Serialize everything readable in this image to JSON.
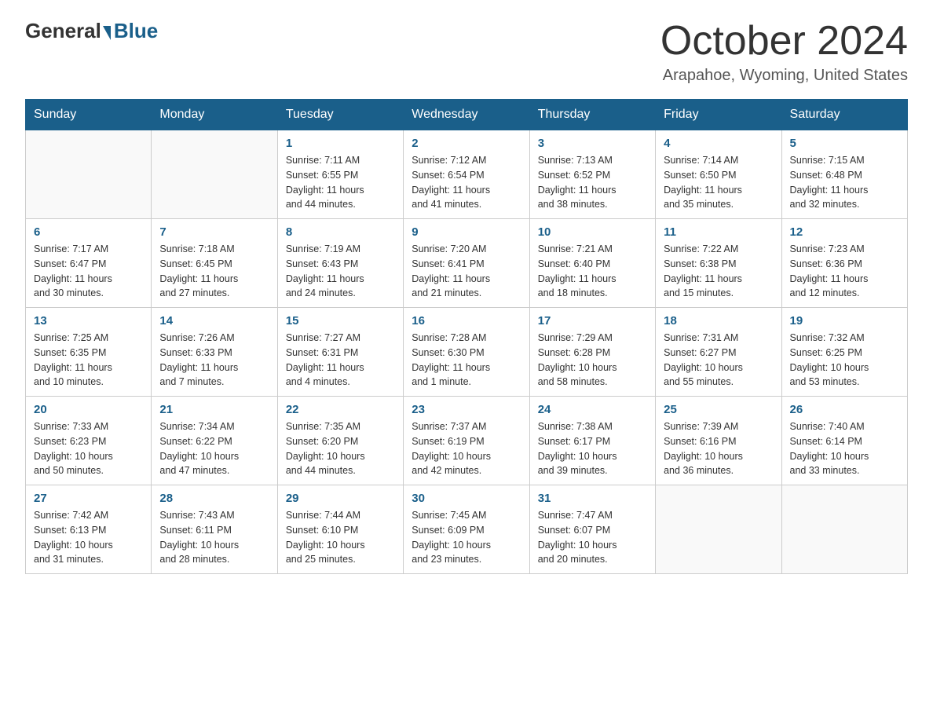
{
  "header": {
    "logo_general": "General",
    "logo_blue": "Blue",
    "month": "October 2024",
    "location": "Arapahoe, Wyoming, United States"
  },
  "days_of_week": [
    "Sunday",
    "Monday",
    "Tuesday",
    "Wednesday",
    "Thursday",
    "Friday",
    "Saturday"
  ],
  "weeks": [
    [
      {
        "day": "",
        "info": ""
      },
      {
        "day": "",
        "info": ""
      },
      {
        "day": "1",
        "info": "Sunrise: 7:11 AM\nSunset: 6:55 PM\nDaylight: 11 hours\nand 44 minutes."
      },
      {
        "day": "2",
        "info": "Sunrise: 7:12 AM\nSunset: 6:54 PM\nDaylight: 11 hours\nand 41 minutes."
      },
      {
        "day": "3",
        "info": "Sunrise: 7:13 AM\nSunset: 6:52 PM\nDaylight: 11 hours\nand 38 minutes."
      },
      {
        "day": "4",
        "info": "Sunrise: 7:14 AM\nSunset: 6:50 PM\nDaylight: 11 hours\nand 35 minutes."
      },
      {
        "day": "5",
        "info": "Sunrise: 7:15 AM\nSunset: 6:48 PM\nDaylight: 11 hours\nand 32 minutes."
      }
    ],
    [
      {
        "day": "6",
        "info": "Sunrise: 7:17 AM\nSunset: 6:47 PM\nDaylight: 11 hours\nand 30 minutes."
      },
      {
        "day": "7",
        "info": "Sunrise: 7:18 AM\nSunset: 6:45 PM\nDaylight: 11 hours\nand 27 minutes."
      },
      {
        "day": "8",
        "info": "Sunrise: 7:19 AM\nSunset: 6:43 PM\nDaylight: 11 hours\nand 24 minutes."
      },
      {
        "day": "9",
        "info": "Sunrise: 7:20 AM\nSunset: 6:41 PM\nDaylight: 11 hours\nand 21 minutes."
      },
      {
        "day": "10",
        "info": "Sunrise: 7:21 AM\nSunset: 6:40 PM\nDaylight: 11 hours\nand 18 minutes."
      },
      {
        "day": "11",
        "info": "Sunrise: 7:22 AM\nSunset: 6:38 PM\nDaylight: 11 hours\nand 15 minutes."
      },
      {
        "day": "12",
        "info": "Sunrise: 7:23 AM\nSunset: 6:36 PM\nDaylight: 11 hours\nand 12 minutes."
      }
    ],
    [
      {
        "day": "13",
        "info": "Sunrise: 7:25 AM\nSunset: 6:35 PM\nDaylight: 11 hours\nand 10 minutes."
      },
      {
        "day": "14",
        "info": "Sunrise: 7:26 AM\nSunset: 6:33 PM\nDaylight: 11 hours\nand 7 minutes."
      },
      {
        "day": "15",
        "info": "Sunrise: 7:27 AM\nSunset: 6:31 PM\nDaylight: 11 hours\nand 4 minutes."
      },
      {
        "day": "16",
        "info": "Sunrise: 7:28 AM\nSunset: 6:30 PM\nDaylight: 11 hours\nand 1 minute."
      },
      {
        "day": "17",
        "info": "Sunrise: 7:29 AM\nSunset: 6:28 PM\nDaylight: 10 hours\nand 58 minutes."
      },
      {
        "day": "18",
        "info": "Sunrise: 7:31 AM\nSunset: 6:27 PM\nDaylight: 10 hours\nand 55 minutes."
      },
      {
        "day": "19",
        "info": "Sunrise: 7:32 AM\nSunset: 6:25 PM\nDaylight: 10 hours\nand 53 minutes."
      }
    ],
    [
      {
        "day": "20",
        "info": "Sunrise: 7:33 AM\nSunset: 6:23 PM\nDaylight: 10 hours\nand 50 minutes."
      },
      {
        "day": "21",
        "info": "Sunrise: 7:34 AM\nSunset: 6:22 PM\nDaylight: 10 hours\nand 47 minutes."
      },
      {
        "day": "22",
        "info": "Sunrise: 7:35 AM\nSunset: 6:20 PM\nDaylight: 10 hours\nand 44 minutes."
      },
      {
        "day": "23",
        "info": "Sunrise: 7:37 AM\nSunset: 6:19 PM\nDaylight: 10 hours\nand 42 minutes."
      },
      {
        "day": "24",
        "info": "Sunrise: 7:38 AM\nSunset: 6:17 PM\nDaylight: 10 hours\nand 39 minutes."
      },
      {
        "day": "25",
        "info": "Sunrise: 7:39 AM\nSunset: 6:16 PM\nDaylight: 10 hours\nand 36 minutes."
      },
      {
        "day": "26",
        "info": "Sunrise: 7:40 AM\nSunset: 6:14 PM\nDaylight: 10 hours\nand 33 minutes."
      }
    ],
    [
      {
        "day": "27",
        "info": "Sunrise: 7:42 AM\nSunset: 6:13 PM\nDaylight: 10 hours\nand 31 minutes."
      },
      {
        "day": "28",
        "info": "Sunrise: 7:43 AM\nSunset: 6:11 PM\nDaylight: 10 hours\nand 28 minutes."
      },
      {
        "day": "29",
        "info": "Sunrise: 7:44 AM\nSunset: 6:10 PM\nDaylight: 10 hours\nand 25 minutes."
      },
      {
        "day": "30",
        "info": "Sunrise: 7:45 AM\nSunset: 6:09 PM\nDaylight: 10 hours\nand 23 minutes."
      },
      {
        "day": "31",
        "info": "Sunrise: 7:47 AM\nSunset: 6:07 PM\nDaylight: 10 hours\nand 20 minutes."
      },
      {
        "day": "",
        "info": ""
      },
      {
        "day": "",
        "info": ""
      }
    ]
  ]
}
